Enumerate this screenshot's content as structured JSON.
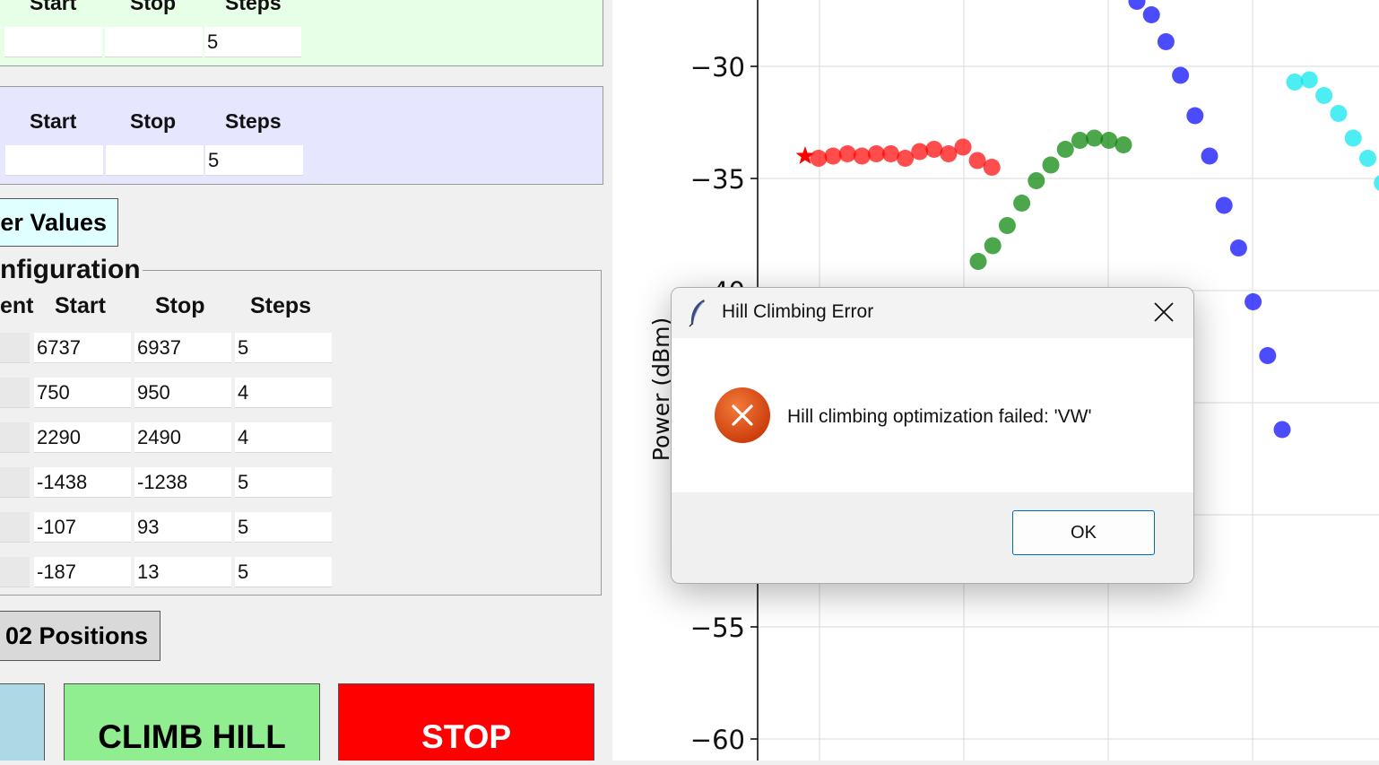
{
  "left": {
    "headers": {
      "start": "Start",
      "stop": "Stop",
      "steps": "Steps"
    },
    "green_row": {
      "start": "",
      "stop": "",
      "steps": "5"
    },
    "blue_row": {
      "start": "",
      "stop": "",
      "steps": "5"
    },
    "update_button": "er Values",
    "config": {
      "title": "nfiguration",
      "col_element": "ent",
      "col_start": "Start",
      "col_stop": "Stop",
      "col_steps": "Steps",
      "rows": [
        {
          "start": "6737",
          "stop": "6937",
          "steps": "5"
        },
        {
          "start": "750",
          "stop": "950",
          "steps": "4"
        },
        {
          "start": "2290",
          "stop": "2490",
          "steps": "4"
        },
        {
          "start": "-1438",
          "stop": "-1238",
          "steps": "5"
        },
        {
          "start": "-107",
          "stop": "93",
          "steps": "5"
        },
        {
          "start": "-187",
          "stop": "13",
          "steps": "5"
        }
      ]
    },
    "save_button": "02 Positions",
    "climb_button": "CLIMB HILL",
    "stop_button": "STOP"
  },
  "colors": {
    "green_panel": "#e6ffe6",
    "blue_panel": "#e6e6ff",
    "update_button": "#e0ffff",
    "climb_button": "#90ee90",
    "stop_button": "#ff0000",
    "light_blue_button": "#add8e6"
  },
  "chart_data": {
    "type": "scatter",
    "ylabel": "Power (dBm)",
    "yticks": [
      "−30",
      "−35",
      "−40",
      "−55",
      "−60"
    ],
    "ylim": [
      -61.0,
      -27.0
    ],
    "grid": true,
    "series": [
      {
        "color": "#ff0000",
        "marker": "circle",
        "values": [
          -34.1,
          -34.0,
          -33.9,
          -34.0,
          -33.9,
          -33.9,
          -34.1,
          -33.8,
          -33.7,
          -33.9,
          -33.6,
          -34.2,
          -34.5
        ],
        "best": -34.0
      },
      {
        "color": "#008000",
        "marker": "circle",
        "values": [
          -38.7,
          -38.0,
          -37.1,
          -36.1,
          -35.1,
          -34.4,
          -33.7,
          -33.3,
          -33.2,
          -33.3,
          -33.5
        ]
      },
      {
        "color": "#0000ff",
        "marker": "circle",
        "values": [
          -27.1,
          -27.7,
          -28.9,
          -30.4,
          -32.2,
          -34.0,
          -36.2,
          -38.1,
          -40.5,
          -42.9,
          -46.2
        ]
      },
      {
        "color": "#00e5ee",
        "marker": "circle",
        "values": [
          -30.7,
          -30.6,
          -31.3,
          -32.1,
          -33.2,
          -34.1,
          -35.2
        ]
      }
    ]
  },
  "dialog": {
    "title": "Hill Climbing Error",
    "message": "Hill climbing optimization failed: 'VW'",
    "ok": "OK",
    "icon": "error-icon"
  }
}
